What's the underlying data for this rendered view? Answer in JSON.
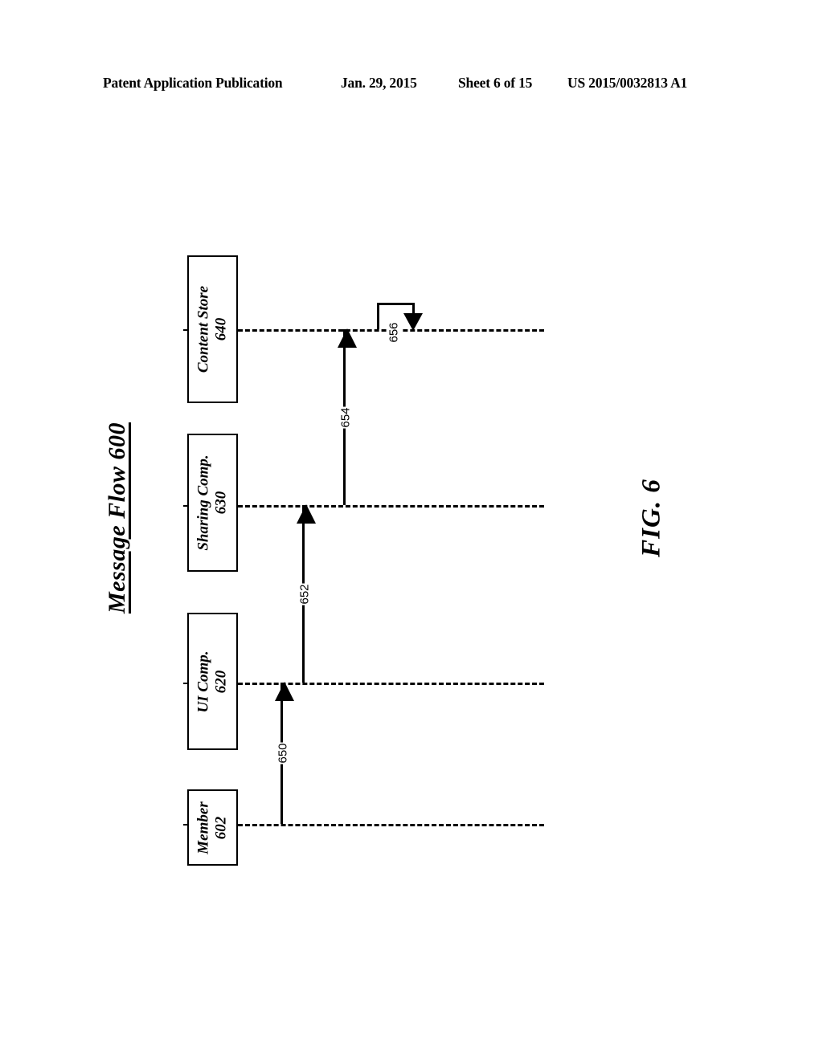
{
  "header": {
    "publication": "Patent Application Publication",
    "date": "Jan. 29, 2015",
    "sheet": "Sheet 6 of 15",
    "document_number": "US 2015/0032813 A1"
  },
  "figure": {
    "title": "Message Flow 600",
    "caption": "FIG. 6",
    "participants": [
      {
        "name": "Content Store",
        "ref": "640"
      },
      {
        "name": "Sharing Comp.",
        "ref": "630"
      },
      {
        "name": "UI Comp.",
        "ref": "620"
      },
      {
        "name": "Member",
        "ref": "602"
      }
    ],
    "messages": [
      {
        "ref": "650",
        "from": "Member 602",
        "to": "UI Comp. 620"
      },
      {
        "ref": "652",
        "from": "UI Comp. 620",
        "to": "Sharing Comp. 630"
      },
      {
        "ref": "654",
        "from": "Sharing Comp. 630",
        "to": "Content Store 640"
      },
      {
        "ref": "656",
        "from": "Content Store 640",
        "to": "Content Store 640"
      }
    ]
  }
}
